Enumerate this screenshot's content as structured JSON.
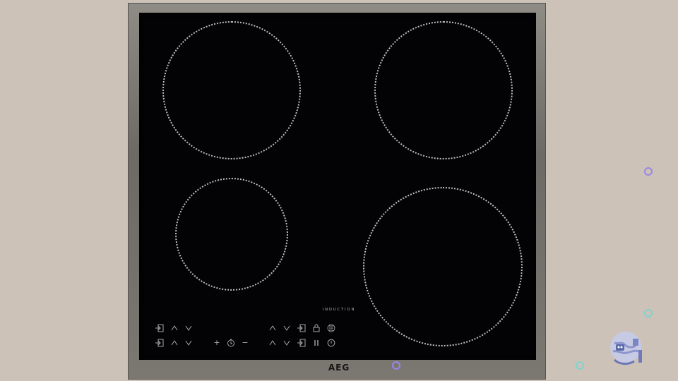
{
  "brand": "AEG",
  "panel_label": "INDUCTION",
  "colors": {
    "background": "#cdc2b7",
    "glass": "#030305",
    "frame": "#7a7772",
    "zone_outline": "#ffffff",
    "accent_purple": "#9b86e6",
    "accent_cyan": "#7fd3cf"
  },
  "zones": [
    "front-left",
    "rear-left",
    "rear-right",
    "front-right"
  ],
  "controls": {
    "left_top": [
      "zone-select-icon",
      "up-arrow-icon",
      "down-arrow-icon"
    ],
    "left_bottom": [
      "zone-select-icon",
      "up-arrow-icon",
      "down-arrow-icon"
    ],
    "center_bottom": [
      "plus-icon",
      "timer-icon",
      "minus-icon"
    ],
    "right_top": [
      "up-arrow-icon",
      "down-arrow-icon",
      "zone-select-icon",
      "lock-icon",
      "menu-icon"
    ],
    "right_bottom": [
      "up-arrow-icon",
      "down-arrow-icon",
      "zone-select-icon",
      "pause-icon",
      "power-icon"
    ],
    "symbols": {
      "plus": "+",
      "minus": "−",
      "up": "^",
      "down": "v"
    }
  }
}
